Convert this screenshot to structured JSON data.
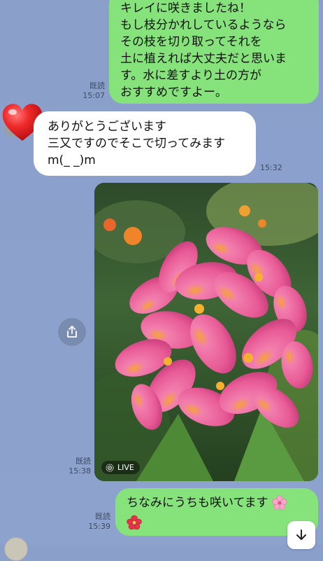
{
  "messages": {
    "m1": {
      "lines": [
        "キレイに咲きましたね！",
        "もし枝分かれしているようなら",
        "その枝を切り取ってそれを",
        "土に植えれば大丈夫だと思いま",
        "す。水に差すより土の方が",
        "おすすめですよー。"
      ],
      "read": "既読",
      "time": "15:07"
    },
    "m2": {
      "lines": [
        "ありがとうございます",
        "三又ですのでそこで切ってみます",
        "m(_ _)m"
      ],
      "time": "15:32"
    },
    "m3": {
      "badge": "LIVE",
      "read": "既読",
      "time": "15:38"
    },
    "m4": {
      "text": "ちなみにうちも咲いてます",
      "read": "既読",
      "time": "15:39"
    }
  },
  "icons": {
    "heart": "heart-sticker-icon",
    "share": "share-icon",
    "scroll_down": "arrow-down-icon",
    "live": "live-photo-icon"
  },
  "colors": {
    "background": "#8aa0cb",
    "sent_bubble": "#86e27a",
    "received_bubble": "#ffffff",
    "heart": "#e8202a"
  }
}
